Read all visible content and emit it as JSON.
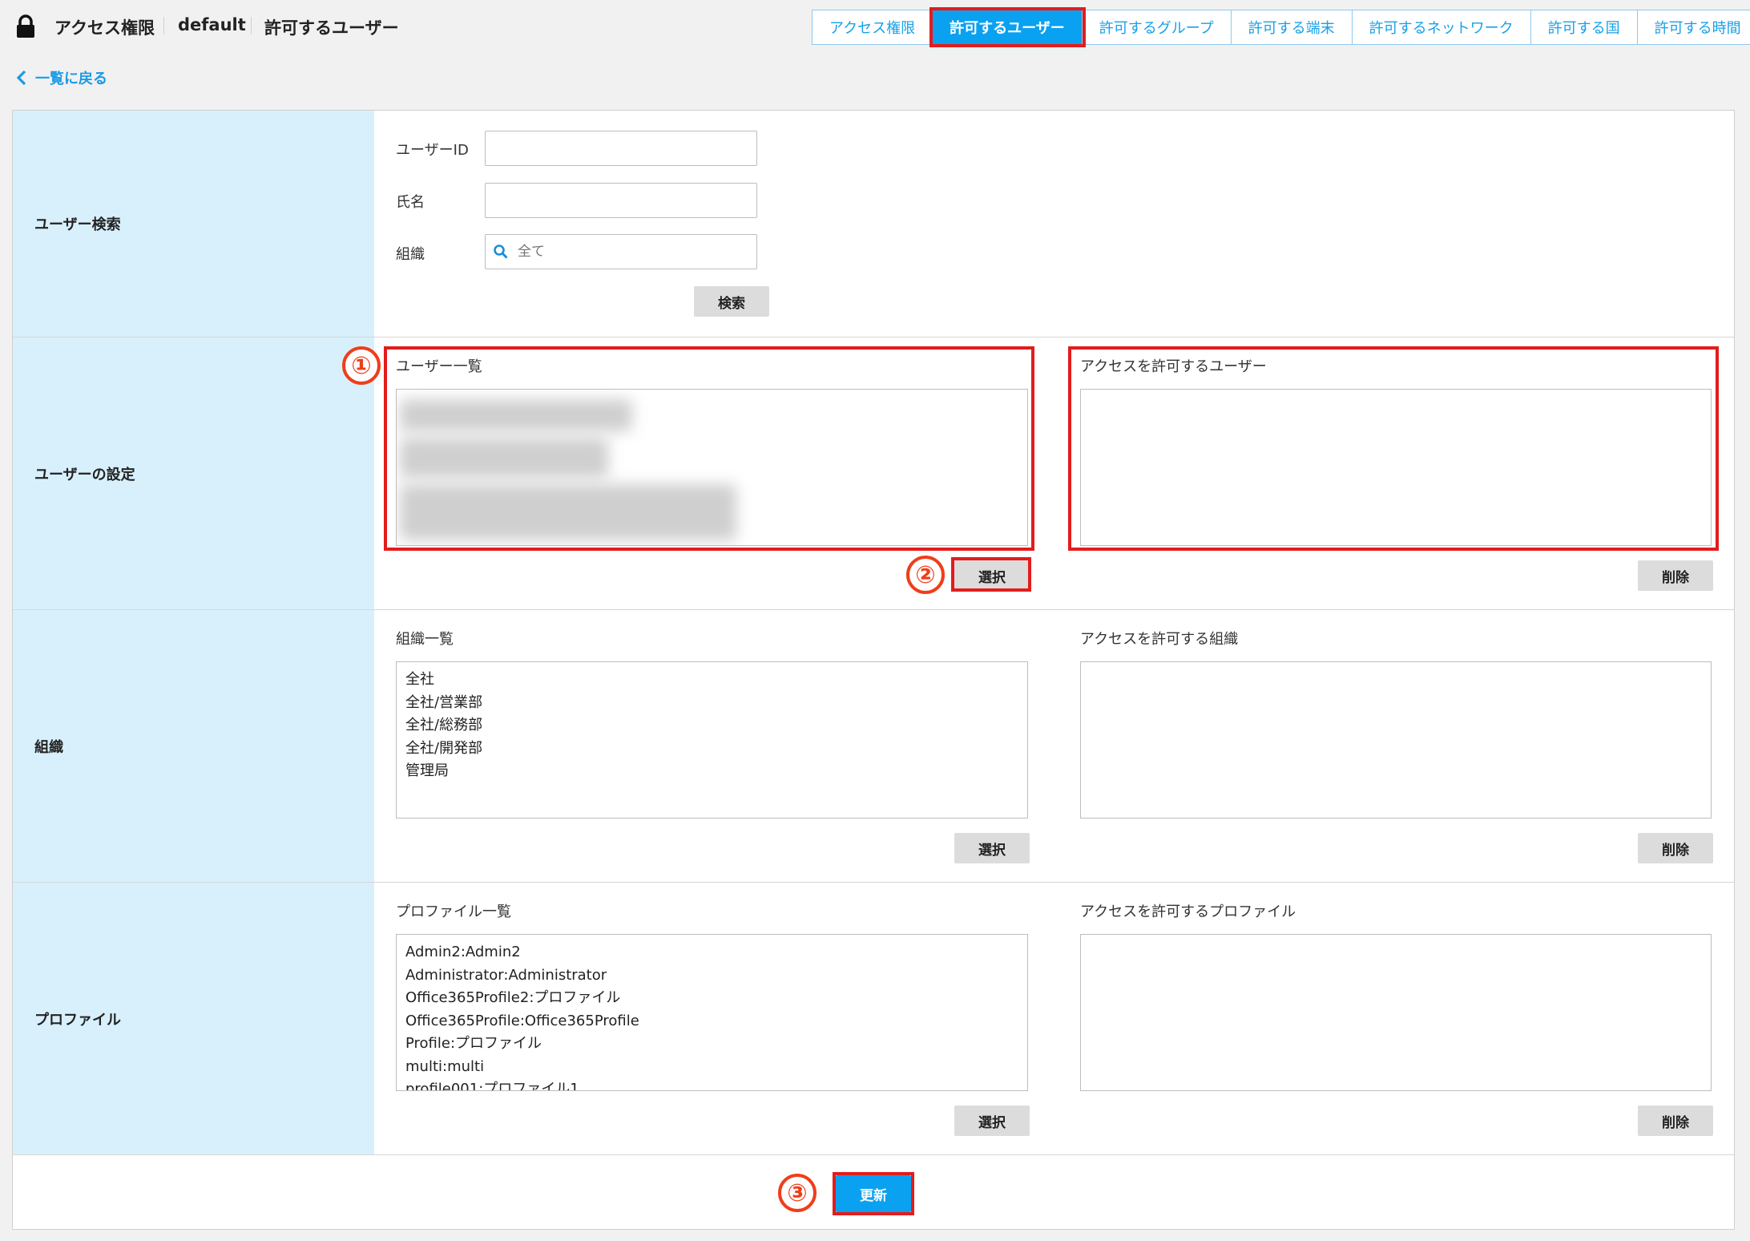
{
  "header": {
    "title": "アクセス権限",
    "policy": "default",
    "section": "許可するユーザー",
    "lock_icon": "lock-icon"
  },
  "tabs": [
    {
      "label": "アクセス権限",
      "active": false
    },
    {
      "label": "許可するユーザー",
      "active": true
    },
    {
      "label": "許可するグループ",
      "active": false
    },
    {
      "label": "許可する端末",
      "active": false
    },
    {
      "label": "許可するネットワーク",
      "active": false
    },
    {
      "label": "許可する国",
      "active": false
    },
    {
      "label": "許可する時間",
      "active": false
    }
  ],
  "back_link": "一覧に戻る",
  "search": {
    "label": "ユーザー検索",
    "user_id_label": "ユーザーID",
    "user_id_value": "",
    "name_label": "氏名",
    "name_value": "",
    "org_label": "組織",
    "org_placeholder": "全て",
    "search_button": "検索"
  },
  "users": {
    "label": "ユーザーの設定",
    "list_title": "ユーザー一覧",
    "allowed_title": "アクセスを許可するユーザー",
    "select_button": "選択",
    "delete_button": "削除"
  },
  "orgs": {
    "label": "組織",
    "list_title": "組織一覧",
    "allowed_title": "アクセスを許可する組織",
    "items": [
      "全社",
      "全社/営業部",
      "全社/総務部",
      "全社/開発部",
      "管理局"
    ],
    "select_button": "選択",
    "delete_button": "削除"
  },
  "profiles": {
    "label": "プロファイル",
    "list_title": "プロファイル一覧",
    "allowed_title": "アクセスを許可するプロファイル",
    "items": [
      "Admin2:Admin2",
      "Administrator:Administrator",
      "Office365Profile2:プロファイル",
      "Office365Profile:Office365Profile",
      "Profile:プロファイル",
      "multi:multi",
      "profile001:プロファイル1"
    ],
    "select_button": "選択",
    "delete_button": "削除"
  },
  "update_button": "更新",
  "markers": [
    "①",
    "②",
    "③"
  ],
  "colors": {
    "accent": "#0aa1f0",
    "highlight": "#e31c1c",
    "label_bg": "#d8f0fc"
  }
}
